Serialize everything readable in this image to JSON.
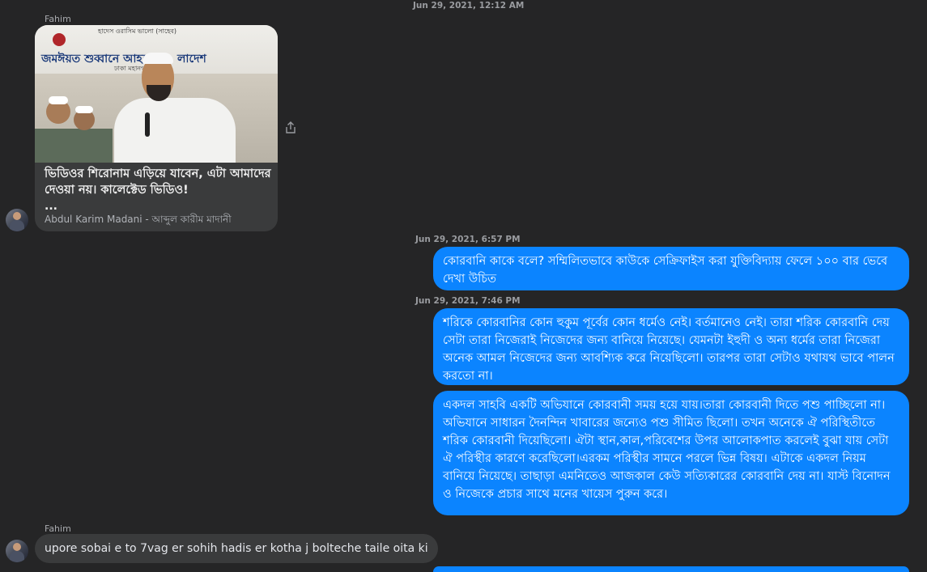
{
  "colors": {
    "background": "#252526",
    "outgoing_bubble": "#0b84ff",
    "incoming_bubble": "#3a3b3c"
  },
  "timestamps": [
    "Jun 29, 2021, 12:12 AM",
    "Jun 29, 2021, 6:57 PM",
    "Jun 29, 2021, 7:46 PM"
  ],
  "thread": {
    "sender_name_1": "Fahim",
    "sender_name_2": "Fahim",
    "shared_video": {
      "title": "ভিডিওর শিরোনাম এড়িয়ে যাবেন, এটা আমাদের দেওয়া নয়। কালেক্টেড ভিডিও!",
      "ellipsis": "...",
      "source": "Abdul Karim Madani - আব্দুল কারীম মাদানী",
      "thumbnail_text_1": "জমঈয়ত শুব্বানে আহলে",
      "thumbnail_text_2": "হাদেস ওরাসিম ভালো (সাহেব)",
      "thumbnail_text_3": "ঢাকা মহানগর দ",
      "thumbnail_text_4": "লাদেশ"
    },
    "share_icon": "share-icon",
    "outgoing": [
      "কোরবানি কাকে বলে? সম্মিলিতভাবে কাউকে সেক্রিফাইস করা যুক্তিবিদ্যায় ফেলে ১০০ বার ভেবে দেখা উচিত",
      "শরিকে কোরবানির কোন হুকুম পূর্বের কোন ধর্মেও নেই। বর্তমানেও নেই। তারা শরিক কোরবানি দেয় সেটা তারা নিজেরাই নিজেদের জন্য বানিয়ে নিয়েছে। যেমনটা ইহুদী ও অন্য ধর্মের তারা নিজেরা অনেক আমল নিজেদের জন্য আবশ্যিক করে নিয়েছিলো। তারপর তারা সেটাও যথাযথ ভাবে পালন করতো না।",
      "একদল সাহবি একটি অভিযানে কোরবানী সময় হয়ে যায়।তারা কোরবানী দিতে পশু পাচ্ছিলো না। অভিযানে সাধারন দৈনন্দিন খাবারের জন্যেও পশু সীমিত ছিলো। তখন অনেকে ঐ পরিস্থিতীতে শরিক কোরবানী দিয়েছিলো। ঐটা স্থান,কাল,পরিবেশের উপর আলোকপাত করলেই বুঝা যায় সেটা ঐ পরিস্থীর কারণে করেছিলো।এরকম পরিস্থীর সামনে পরলে ভিন্ন বিষয়। এটাকে একদল নিয়ম বানিয়ে নিয়েছে। তাছাড়া এমনিতেও আজকাল কেউ সত্যিকারের কোরবানি দেয় না। যাস্ট বিনোদন ও নিজেকে প্রচার সাথে মনের খায়েস পুরুন করে।"
    ],
    "incoming_text": "upore sobai e to 7vag er sohih hadis er kotha j bolteche taile oita ki"
  }
}
